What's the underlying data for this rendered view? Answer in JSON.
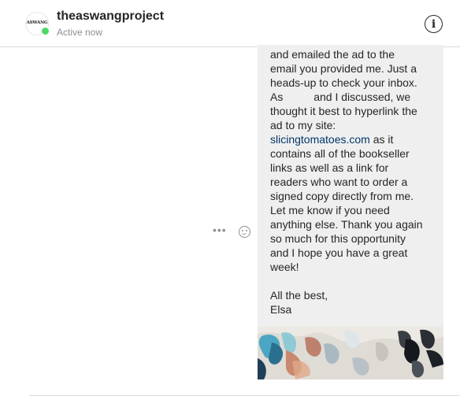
{
  "header": {
    "username": "theaswangproject",
    "status": "Active now",
    "avatar_text": "ASWANG",
    "info_icon": "info-icon",
    "info_glyph": "i"
  },
  "message": {
    "lines": [
      "and emailed the ad to the",
      "email you provided me. Just a",
      "heads-up to check your inbox.",
      "As          and I discussed, we",
      "thought it best to hyperlink the",
      "ad to my site:"
    ],
    "link_text": "slicingtomatoes.com",
    "link_suffix": " as it",
    "lines_after": [
      "contains all of the bookseller",
      "links as well as a link for",
      "readers who want to order a",
      "signed copy directly from me.",
      "Let me know if you need",
      "anything else. Thank you again",
      "so much for this opportunity",
      "and I hope you have a great",
      "week!"
    ],
    "signoff": "All the best,",
    "signature": "Elsa"
  },
  "actions": {
    "more_label": "•••",
    "more_icon": "more-options-icon",
    "react_icon": "emoji-react-icon"
  },
  "colors": {
    "bubble": "#efefef",
    "link": "#00376b",
    "online": "#4cd964",
    "muted": "#8e8e8e"
  }
}
